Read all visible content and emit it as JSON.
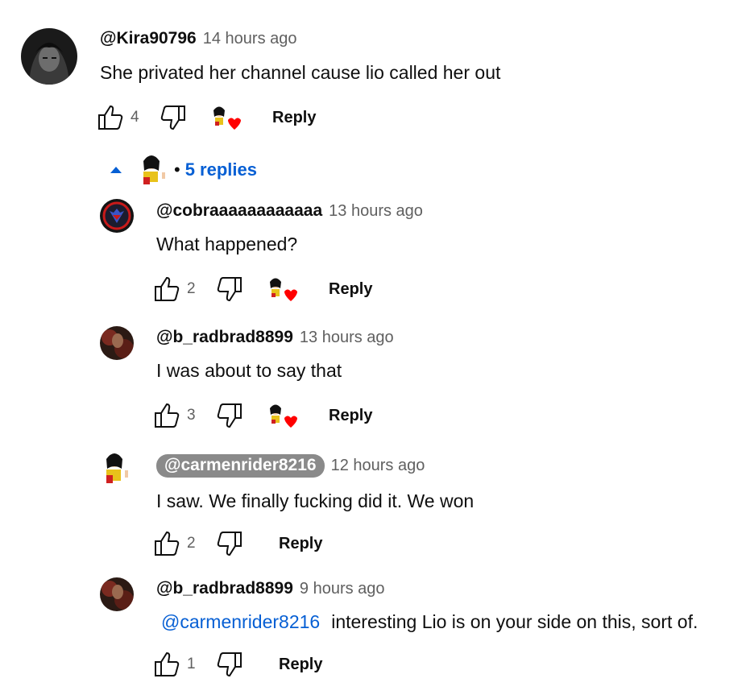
{
  "icons": {
    "like": "thumbs-up-icon",
    "dislike": "thumbs-down-icon",
    "creator_heart": "creator-heart-icon",
    "collapse": "caret-up-icon"
  },
  "colors": {
    "link_blue": "#065fd4",
    "heart_red": "#ff0000",
    "secondary_text": "#606060",
    "chip_gray": "#8a8a8a"
  },
  "top_comment": {
    "author": "@Kira90796",
    "time": "14 hours ago",
    "text": "She privated her channel cause lio called her out",
    "likes": "4",
    "reply_label": "Reply"
  },
  "replies_toggle": {
    "label": "5 replies",
    "separator": "•"
  },
  "replies": [
    {
      "author": "@cobraaaaaaaaaaaa",
      "time": "13 hours ago",
      "text": "What happened?",
      "likes": "2",
      "reply_label": "Reply"
    },
    {
      "author": "@b_radbrad8899",
      "time": "13 hours ago",
      "text": "I was about to say that",
      "likes": "3",
      "reply_label": "Reply"
    },
    {
      "author": "@carmenrider8216",
      "time": "12 hours ago",
      "text": "I saw. We finally fucking did it. We won",
      "likes": "2",
      "reply_label": "Reply"
    },
    {
      "author": "@b_radbrad8899",
      "time": "9 hours ago",
      "mention": "@carmenrider8216",
      "text": "interesting Lio is on your side on this, sort of.",
      "likes": "1",
      "reply_label": "Reply"
    }
  ]
}
